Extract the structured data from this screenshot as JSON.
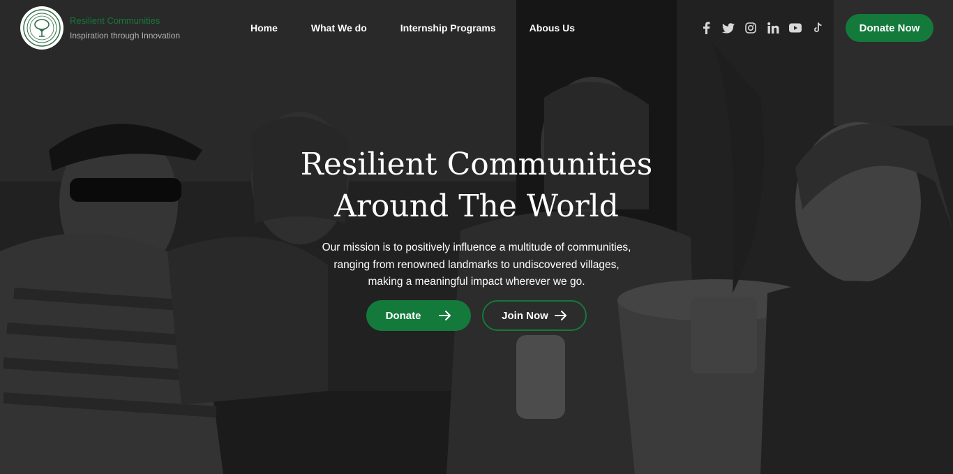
{
  "brand": {
    "name": "Resilient Communities",
    "tagline": "Inspiration through Innovation",
    "accent_color": "#147a3c"
  },
  "nav": {
    "items": [
      {
        "label": "Home"
      },
      {
        "label": "What We do"
      },
      {
        "label": "Internship Programs"
      },
      {
        "label": "Abous Us"
      }
    ]
  },
  "socials": [
    "facebook-icon",
    "twitter-icon",
    "instagram-icon",
    "linkedin-icon",
    "youtube-icon",
    "tiktok-icon"
  ],
  "header": {
    "donate_label": "Donate Now"
  },
  "hero": {
    "title_line1": "Resilient Communities",
    "title_line2": "Around The World",
    "mission_line1": "Our mission is to positively influence a multitude of communities,",
    "mission_line2": "ranging from renowned landmarks to undiscovered villages,",
    "mission_line3": "making a meaningful impact wherever we go.",
    "donate_label": "Donate",
    "join_label": "Join Now"
  }
}
